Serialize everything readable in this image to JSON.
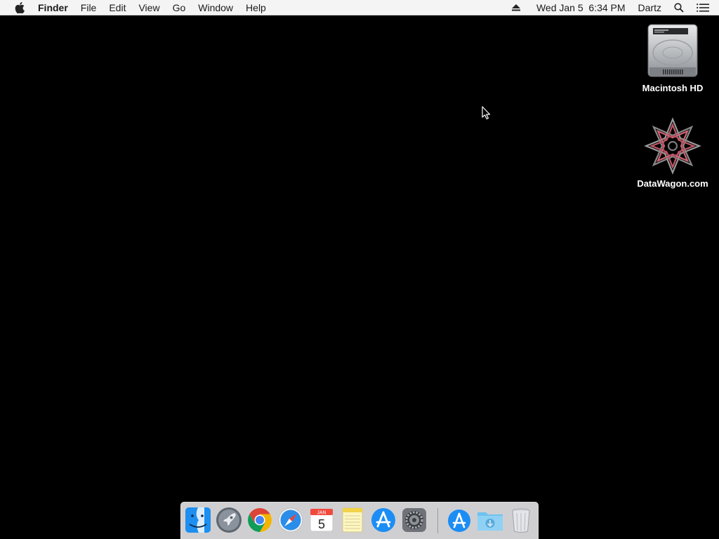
{
  "menubar": {
    "apple_icon": "apple-icon",
    "app_name": "Finder",
    "menus": [
      "File",
      "Edit",
      "View",
      "Go",
      "Window",
      "Help"
    ],
    "status": {
      "eject_icon": "eject-icon",
      "datetime": "Wed Jan 5  6:34 PM",
      "user": "Dartz",
      "search_icon": "spotlight-search-icon",
      "notification_icon": "notification-center-icon"
    }
  },
  "desktop": {
    "background_color": "#000000",
    "icons": [
      {
        "label": "Macintosh HD",
        "icon": "hard-drive-icon"
      },
      {
        "label": "DataWagon.com",
        "icon": "network-volume-icon"
      }
    ]
  },
  "calendar": {
    "month": "JAN",
    "day": "5"
  },
  "dock": {
    "apps": [
      {
        "name": "Finder",
        "icon": "finder-icon",
        "running": true
      },
      {
        "name": "Launchpad",
        "icon": "launchpad-icon",
        "running": false
      },
      {
        "name": "Google Chrome",
        "icon": "chrome-icon",
        "running": false
      },
      {
        "name": "Safari",
        "icon": "safari-icon",
        "running": false
      },
      {
        "name": "Calendar",
        "icon": "calendar-icon",
        "running": false
      },
      {
        "name": "Notes",
        "icon": "notes-icon",
        "running": false
      },
      {
        "name": "App Store",
        "icon": "app-store-icon",
        "running": false
      },
      {
        "name": "System Preferences",
        "icon": "system-preferences-icon",
        "running": false
      }
    ],
    "others": [
      {
        "name": "Applications",
        "icon": "applications-stack-icon"
      },
      {
        "name": "Downloads",
        "icon": "downloads-folder-icon"
      },
      {
        "name": "Trash",
        "icon": "trash-icon"
      }
    ]
  }
}
